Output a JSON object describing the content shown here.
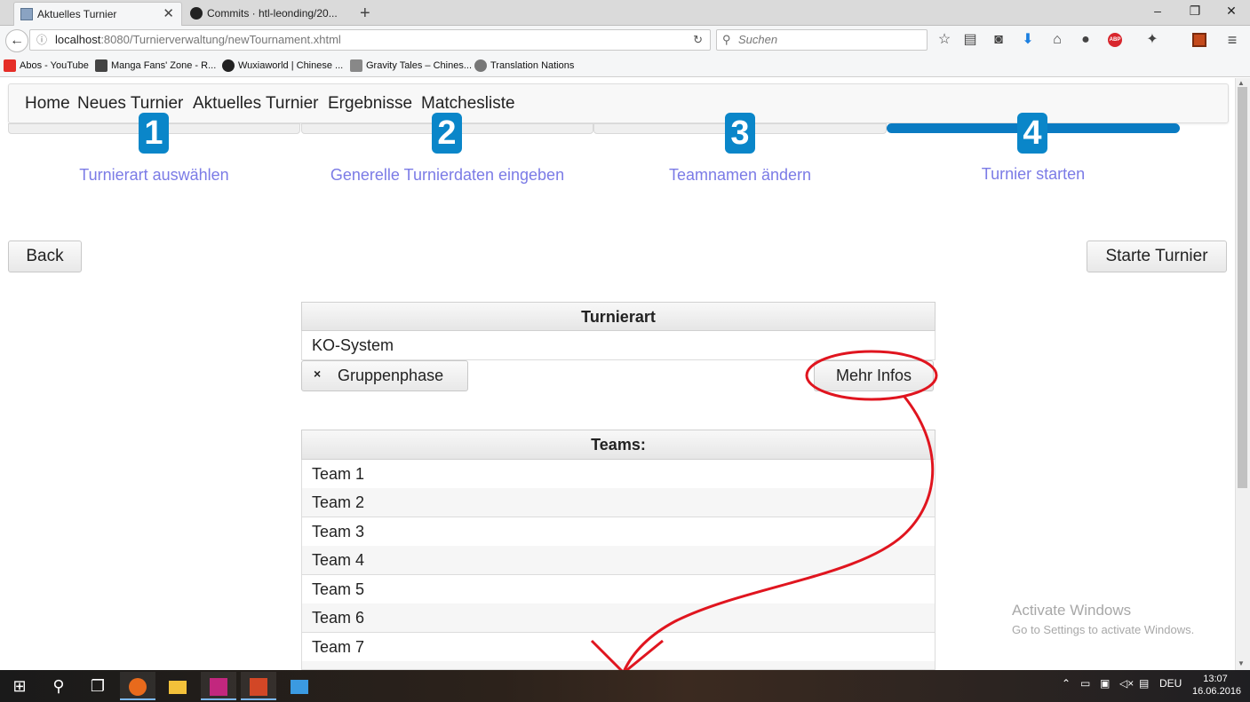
{
  "browser": {
    "tabs": [
      {
        "title": "Aktuelles Turnier",
        "active": true
      },
      {
        "title": "Commits · htl-leonding/20...",
        "active": false
      }
    ],
    "window_controls": {
      "minimize": "–",
      "restore": "❐",
      "close": "✕"
    },
    "new_tab": "+",
    "url_host": "localhost",
    "url_rest": ":8080/Turnierverwaltung/newTournament.xhtml",
    "search_placeholder": "Suchen",
    "bookmarks": [
      {
        "label": "Abos - YouTube",
        "color": "#e52d27"
      },
      {
        "label": "Manga Fans' Zone - R...",
        "color": "#444444"
      },
      {
        "label": "Wuxiaworld | Chinese ...",
        "color": "#222222"
      },
      {
        "label": "Gravity Tales – Chines...",
        "color": "#888888"
      },
      {
        "label": "Translation Nations",
        "color": "#777777"
      }
    ]
  },
  "app": {
    "nav": [
      "Home",
      "Neues Turnier",
      "Aktuelles Turnier",
      "Ergebnisse",
      "Matchesliste"
    ],
    "steps": [
      {
        "number": "1",
        "label": "Turnierart auswählen"
      },
      {
        "number": "2",
        "label": "Generelle Turnierdaten eingeben"
      },
      {
        "number": "3",
        "label": "Teamnamen ändern"
      },
      {
        "number": "4",
        "label": "Turnier starten"
      }
    ],
    "active_step": 4,
    "back_button": "Back",
    "start_button": "Starte Turnier",
    "type_panel": {
      "header": "Turnierart",
      "value": "KO-System",
      "group_toggle_icon": "×",
      "group_toggle_label": "Gruppenphase",
      "more_info_button": "Mehr Infos"
    },
    "teams_panel": {
      "header": "Teams:",
      "teams": [
        "Team 1",
        "Team 2",
        "Team 3",
        "Team 4",
        "Team 5",
        "Team 6",
        "Team 7"
      ]
    }
  },
  "watermark": {
    "line1": "Activate Windows",
    "line2": "Go to Settings to activate Windows."
  },
  "taskbar": {
    "language": "DEU",
    "time": "13:07",
    "date": "16.06.2016"
  },
  "colors": {
    "step_blue": "#0a86c9",
    "step_label": "#7b7be6",
    "annotation_red": "#e0151f"
  }
}
